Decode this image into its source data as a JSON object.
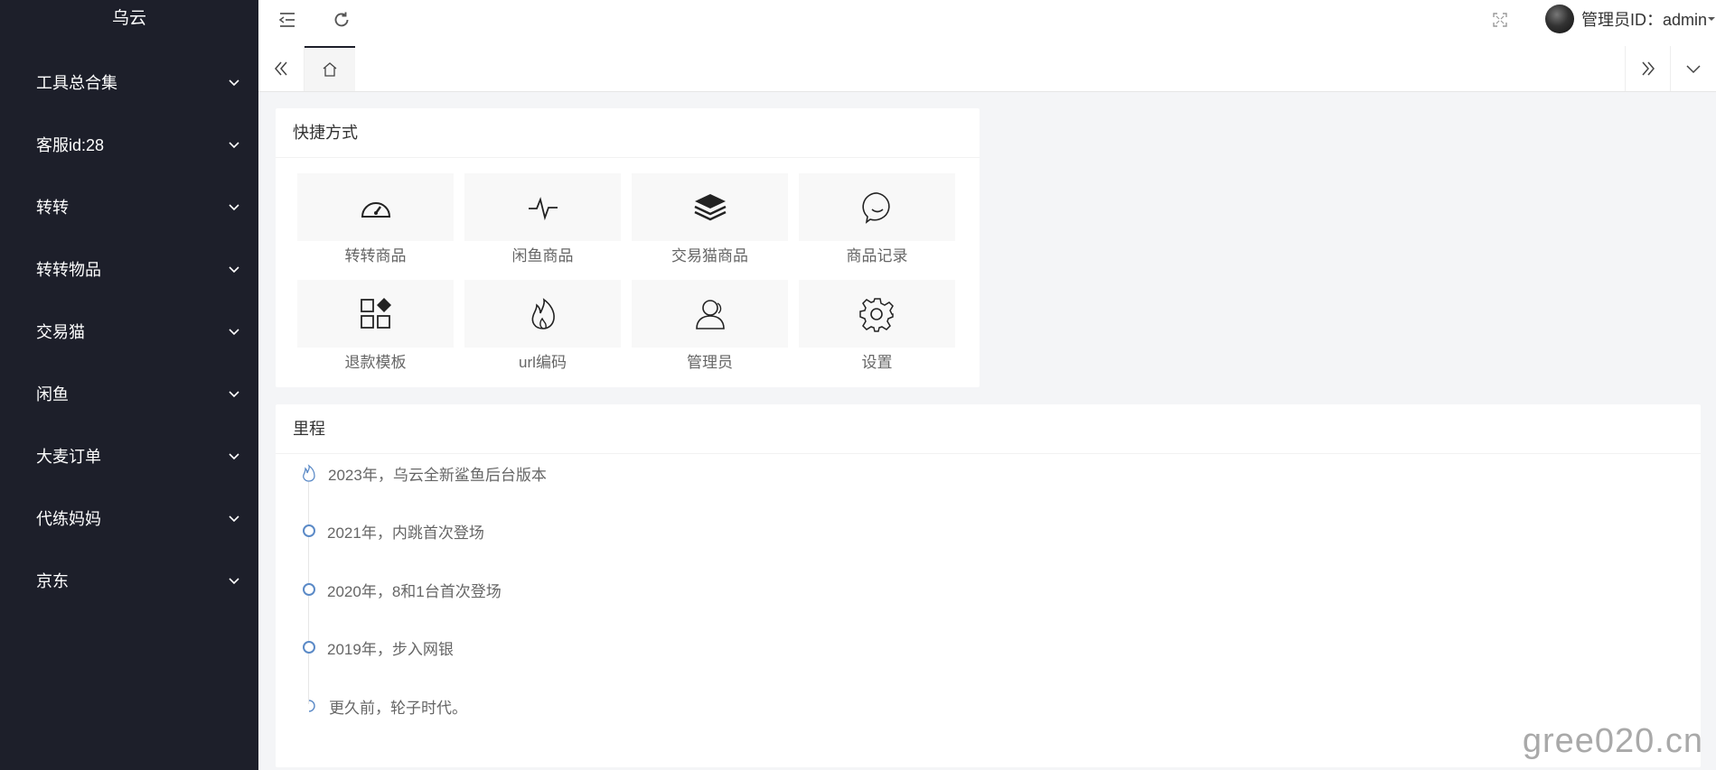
{
  "sidebar": {
    "logo": "乌云",
    "items": [
      {
        "label": "工具总合集"
      },
      {
        "label": "客服id:28"
      },
      {
        "label": "转转"
      },
      {
        "label": "转转物品"
      },
      {
        "label": "交易猫"
      },
      {
        "label": "闲鱼"
      },
      {
        "label": "大麦订单"
      },
      {
        "label": "代练妈妈"
      },
      {
        "label": "京东"
      }
    ]
  },
  "header": {
    "user_label": "管理员ID：admin"
  },
  "shortcuts": {
    "title": "快捷方式",
    "items": [
      {
        "label": "转转商品",
        "icon": "dashboard-icon"
      },
      {
        "label": "闲鱼商品",
        "icon": "pulse-icon"
      },
      {
        "label": "交易猫商品",
        "icon": "layers-icon"
      },
      {
        "label": "商品记录",
        "icon": "chat-bubble-icon"
      },
      {
        "label": "退款模板",
        "icon": "apps-icon"
      },
      {
        "label": "url编码",
        "icon": "fire-icon"
      },
      {
        "label": "管理员",
        "icon": "user-icon"
      },
      {
        "label": "设置",
        "icon": "gear-icon"
      }
    ]
  },
  "milestones": {
    "title": "里程",
    "items": [
      {
        "text": "2023年，乌云全新鲨鱼后台版本"
      },
      {
        "text": "2021年，内跳首次登场"
      },
      {
        "text": "2020年，8和1台首次登场"
      },
      {
        "text": "2019年，步入网银"
      },
      {
        "text": "更久前，轮子时代。"
      }
    ]
  },
  "watermark": "gree020.cn",
  "colors": {
    "sidebar_bg": "#1d1f2a",
    "timeline_accent": "#5b8ac7"
  }
}
